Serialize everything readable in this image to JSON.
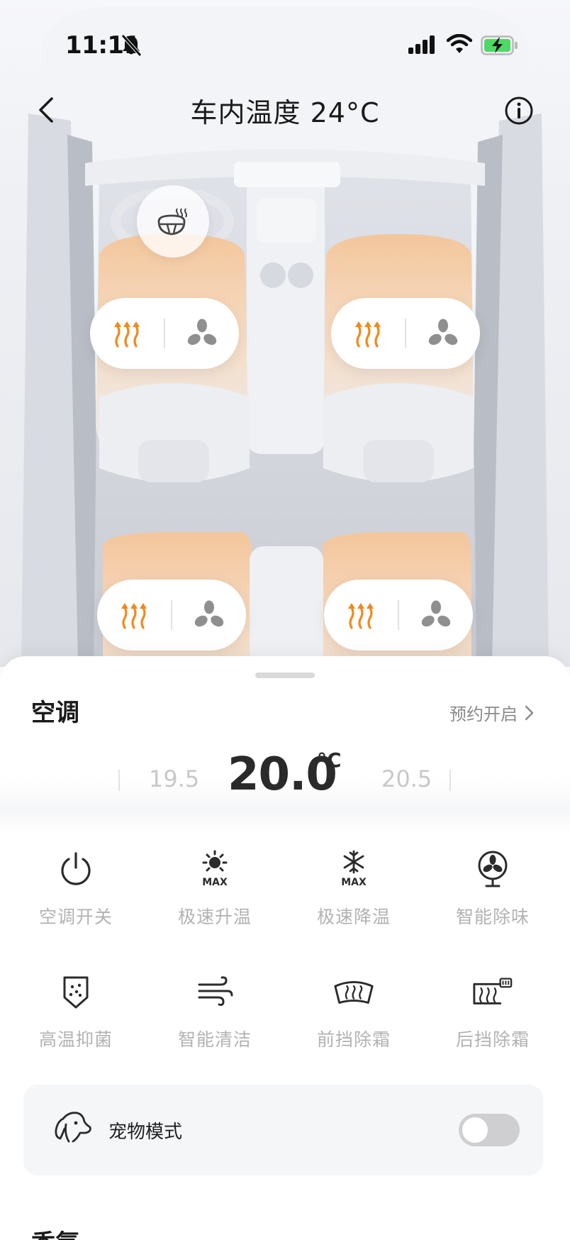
{
  "status_bar": {
    "time": "11:11"
  },
  "header": {
    "title": "车内温度 24°C"
  },
  "seats": [
    {
      "id": "front-left",
      "heat_icon": "seat-heat-icon",
      "vent_icon": "fan-icon"
    },
    {
      "id": "front-right",
      "heat_icon": "seat-heat-icon",
      "vent_icon": "fan-icon"
    },
    {
      "id": "rear-left",
      "heat_icon": "seat-heat-icon",
      "vent_icon": "fan-icon"
    },
    {
      "id": "rear-right",
      "heat_icon": "seat-heat-icon",
      "vent_icon": "fan-icon"
    }
  ],
  "colors": {
    "heat_orange": "#f08a1c",
    "icon_dark": "#2b2b2b",
    "label_grey": "#b2b2b2"
  },
  "ac": {
    "section_title": "空调",
    "schedule_label": "预约开启",
    "temperature": {
      "prev": "19.5",
      "current": "20.0",
      "unit": "°C",
      "next": "20.5"
    },
    "functions": [
      {
        "label": "空调开关",
        "icon": "power-icon"
      },
      {
        "label": "极速升温",
        "icon": "sun-max-icon"
      },
      {
        "label": "极速降温",
        "icon": "snowflake-max-icon"
      },
      {
        "label": "智能除味",
        "icon": "fan-circle-icon"
      },
      {
        "label": "高温抑菌",
        "icon": "shield-dots-icon"
      },
      {
        "label": "智能清洁",
        "icon": "wind-icon"
      },
      {
        "label": "前挡除霜",
        "icon": "front-defrost-icon"
      },
      {
        "label": "后挡除霜",
        "icon": "rear-defrost-icon"
      }
    ],
    "pet_mode": {
      "label": "宠物模式",
      "enabled": false
    }
  },
  "fragrance": {
    "section_title": "香氛"
  }
}
